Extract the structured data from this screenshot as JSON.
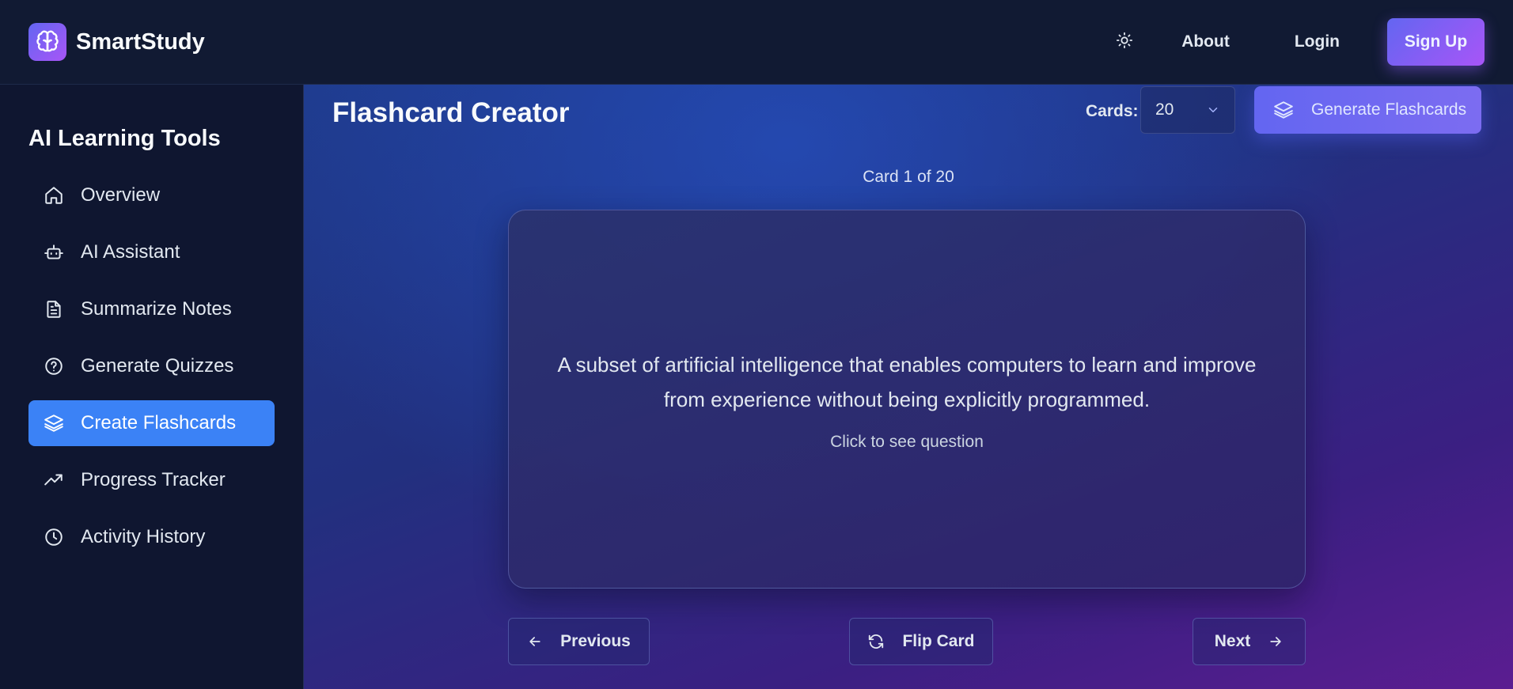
{
  "header": {
    "brand_name": "SmartStudy",
    "logo_icon": "brain-icon",
    "theme_icon": "sun-icon",
    "about_label": "About",
    "login_label": "Login",
    "signup_label": "Sign Up"
  },
  "sidebar": {
    "title": "AI Learning Tools",
    "items": [
      {
        "label": "Overview",
        "icon": "home-icon",
        "active": false
      },
      {
        "label": "AI Assistant",
        "icon": "bot-icon",
        "active": false
      },
      {
        "label": "Summarize Notes",
        "icon": "document-icon",
        "active": false
      },
      {
        "label": "Generate Quizzes",
        "icon": "help-circle-icon",
        "active": false
      },
      {
        "label": "Create Flashcards",
        "icon": "layers-icon",
        "active": true
      },
      {
        "label": "Progress Tracker",
        "icon": "trending-up-icon",
        "active": false
      },
      {
        "label": "Activity History",
        "icon": "clock-icon",
        "active": false
      }
    ]
  },
  "main": {
    "title": "Flashcard Creator",
    "cards_label": "Cards:",
    "cards_count": "20",
    "generate_label": "Generate Flashcards",
    "card_counter": "Card 1 of 20",
    "card_text": "A subset of artificial intelligence that enables computers to learn and improve from experience without being explicitly programmed.",
    "card_hint": "Click to see question",
    "previous_label": "Previous",
    "flip_label": "Flip Card",
    "next_label": "Next"
  },
  "colors": {
    "accent": "#3b82f6",
    "brand_gradient_start": "#6366f1",
    "brand_gradient_end": "#a855f7",
    "sidebar_bg": "#0f1630",
    "header_bg": "#111a33"
  }
}
